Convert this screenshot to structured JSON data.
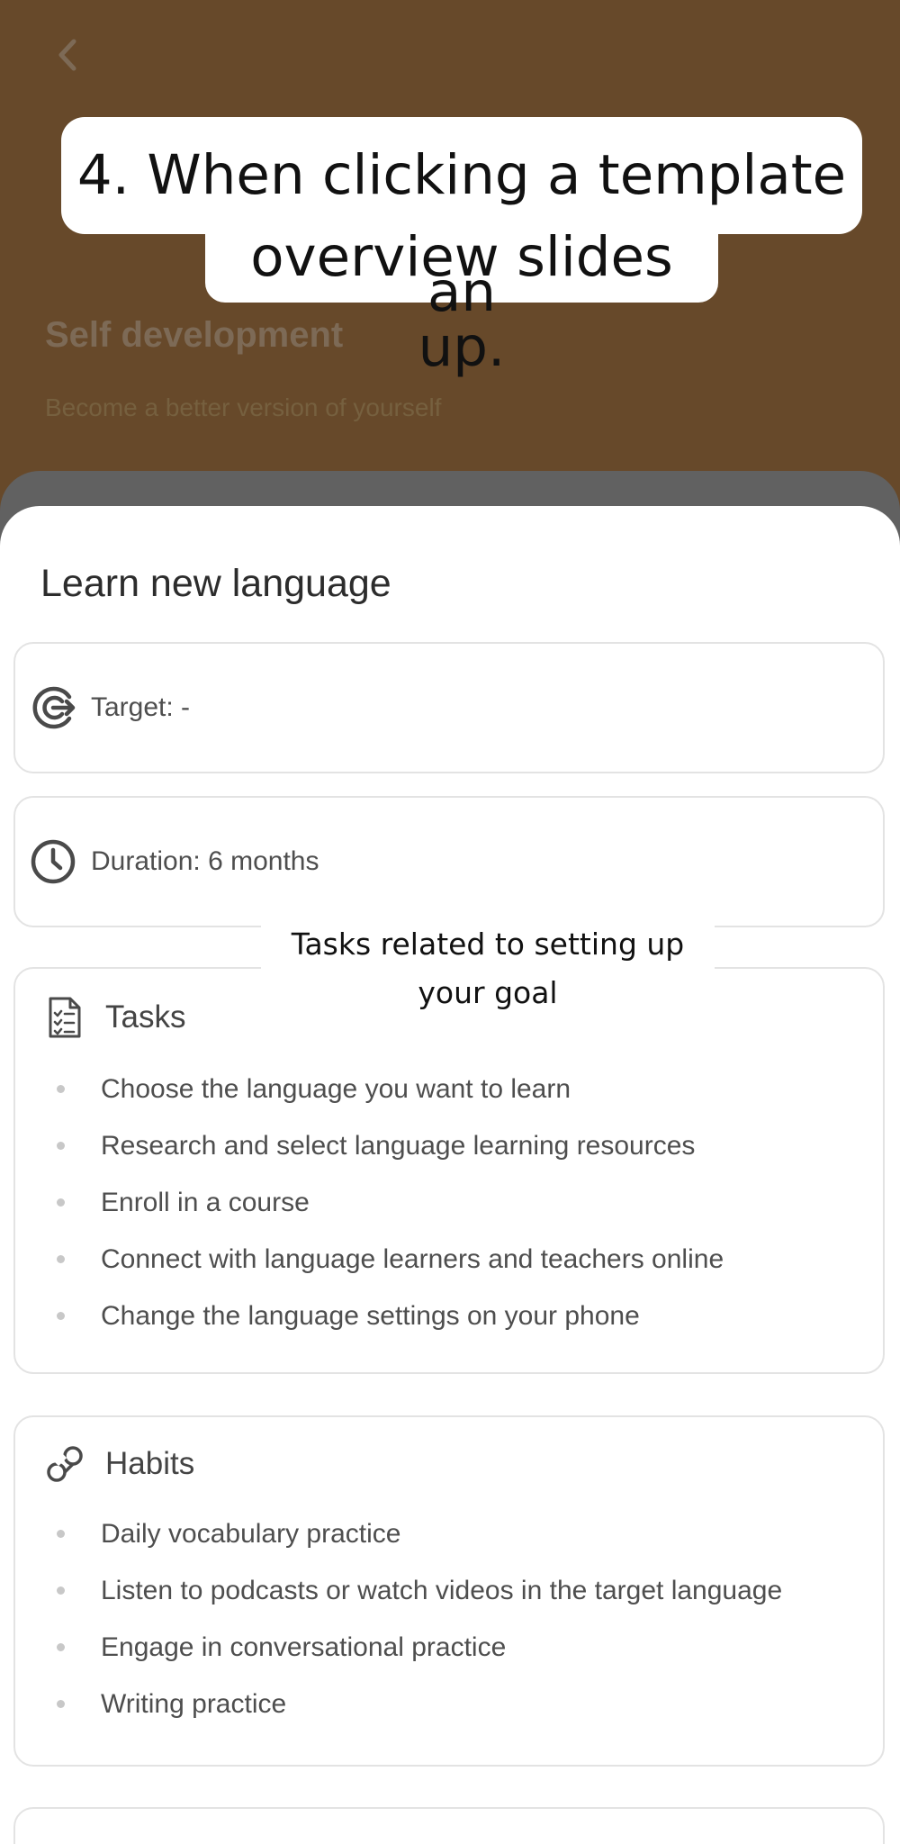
{
  "header": {
    "title": "Self development",
    "subtitle": "Become a better version of yourself"
  },
  "captions": {
    "line1": "4. When clicking a template an",
    "line2": "overview slides up.",
    "tip": "Tasks related to setting up your goal"
  },
  "sheet": {
    "title": "Learn new language",
    "target": "Target: -",
    "duration": "Duration: 6 months",
    "tasks": {
      "title": "Tasks",
      "items": [
        "Choose the language you want to learn",
        "Research and select language learning resources",
        "Enroll in a course",
        "Connect with language learners and teachers online",
        "Change the language settings on your phone"
      ]
    },
    "habits": {
      "title": "Habits",
      "items": [
        "Daily vocabulary practice",
        "Listen to podcasts or watch videos in the target language",
        "Engage in conversational practice",
        "Writing practice"
      ]
    }
  },
  "icons": {
    "back": "chevron-left-icon",
    "target": "target-icon",
    "duration": "clock-icon",
    "tasks": "checklist-icon",
    "habits": "infinity-loop-icon"
  },
  "colors": {
    "header_bg": "#67492a",
    "sheet_bg": "#ffffff",
    "card_border": "#e3e3e3",
    "text_primary": "#2c2c2c",
    "text_secondary": "#4e4e4e"
  }
}
